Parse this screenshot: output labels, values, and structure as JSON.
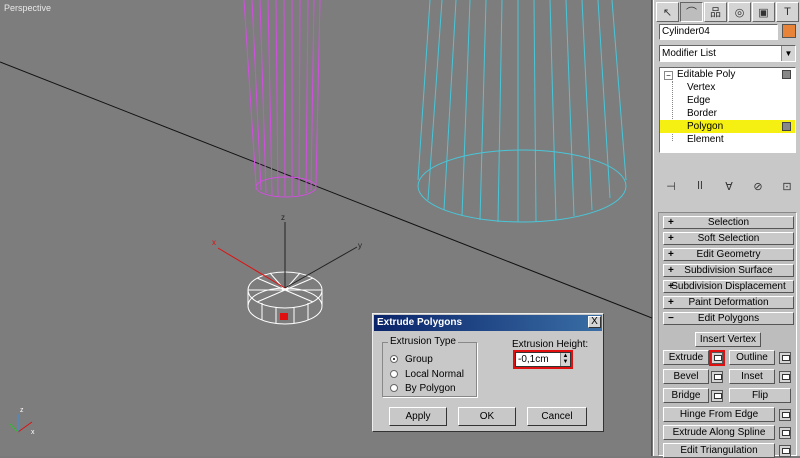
{
  "viewport": {
    "label": "Perspective"
  },
  "command_panel": {
    "tabs": [
      "create",
      "modify",
      "hierarchy",
      "motion",
      "display",
      "utilities"
    ],
    "object_name": "Cylinder04",
    "object_color": "#e8833a",
    "modifier_list": "Modifier List",
    "stack": {
      "root": "Editable Poly",
      "children": [
        "Vertex",
        "Edge",
        "Border",
        "Polygon",
        "Element"
      ],
      "selected": "Polygon"
    },
    "rollouts": {
      "selection": "Selection",
      "soft_selection": "Soft Selection",
      "edit_geometry": "Edit Geometry",
      "subdivision_surface": "Subdivision Surface",
      "subdivision_displacement": "Subdivision Displacement",
      "paint_deformation": "Paint Deformation",
      "edit_polygons": "Edit Polygons"
    },
    "edit_polygons": {
      "insert_vertex": "Insert Vertex",
      "extrude": "Extrude",
      "outline": "Outline",
      "bevel": "Bevel",
      "inset": "Inset",
      "bridge": "Bridge",
      "flip": "Flip",
      "hinge_from_edge": "Hinge From Edge",
      "extrude_along_spline": "Extrude Along Spline",
      "edit_triangulation": "Edit Triangulation"
    }
  },
  "dialog": {
    "title": "Extrude Polygons",
    "close": "X",
    "extrusion_type_label": "Extrusion Type",
    "options": [
      "Group",
      "Local Normal",
      "By Polygon"
    ],
    "selected_option": "Group",
    "height_label": "Extrusion Height:",
    "height_value": "-0,1cm",
    "apply": "Apply",
    "ok": "OK",
    "cancel": "Cancel"
  },
  "axis": {
    "x": "x",
    "y": "y",
    "z": "z"
  },
  "colors": {
    "viewport_bg": "#7d7d7d",
    "magenta_wire": "#d14fe0",
    "cyan_wire": "#49c6d8",
    "selection_yellow": "#f5ef12",
    "highlight_red": "#e01010"
  }
}
